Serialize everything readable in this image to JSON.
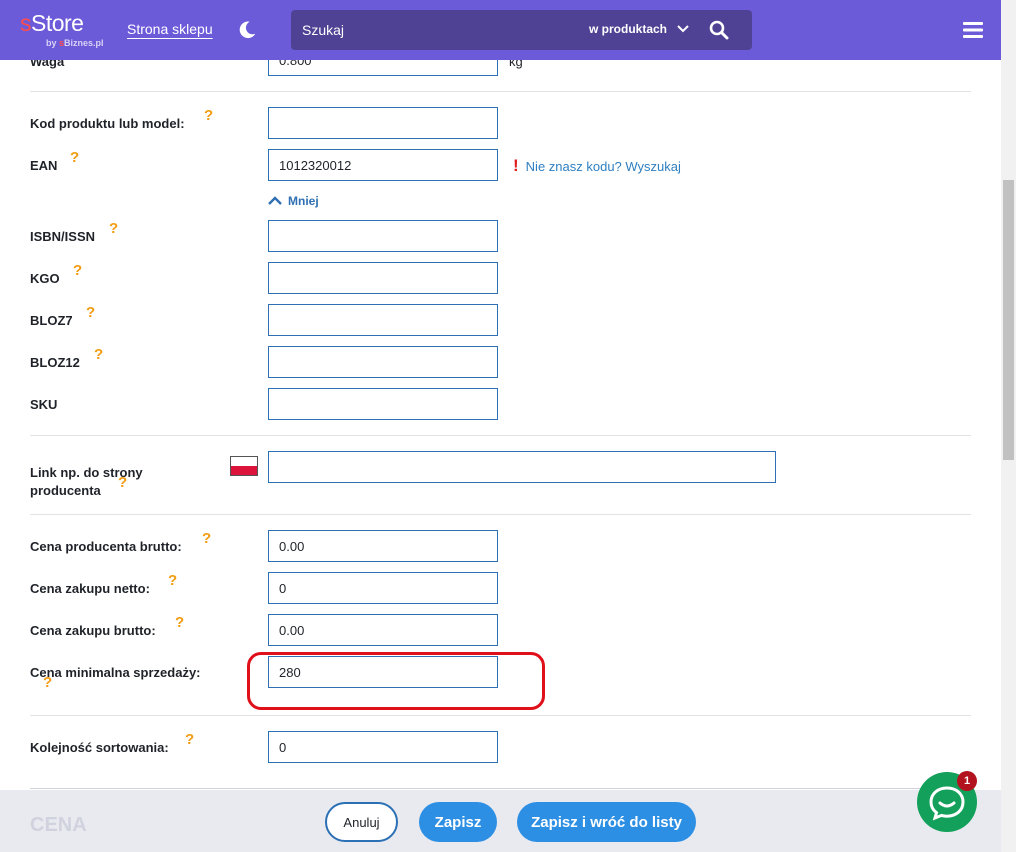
{
  "header": {
    "logo_main_s": "s",
    "logo_main_rest": "Store",
    "logo_sub_by": "by ",
    "logo_sub_s": "s",
    "logo_sub_rest": "Biznes.pl",
    "store_link": "Strona sklepu",
    "search_placeholder": "Szukaj",
    "search_scope": "w produktach"
  },
  "form": {
    "weight": {
      "label": "Waga",
      "value": "0.800",
      "unit": "kg"
    },
    "product_code": {
      "label": "Kod produktu lub model:",
      "value": ""
    },
    "ean": {
      "label": "EAN",
      "value": "1012320012",
      "hint": "Nie znasz kodu? Wyszukaj",
      "hint_mark": "!"
    },
    "less_toggle": "Mniej",
    "isbn": {
      "label": "ISBN/ISSN",
      "value": ""
    },
    "kgo": {
      "label": "KGO",
      "value": ""
    },
    "bloz7": {
      "label": "BLOZ7",
      "value": ""
    },
    "bloz12": {
      "label": "BLOZ12",
      "value": ""
    },
    "sku": {
      "label": "SKU",
      "value": ""
    },
    "manufacturer_link": {
      "label_line1": "Link np. do strony",
      "label_line2": "producenta",
      "value": ""
    },
    "manufacturer_price_gross": {
      "label": "Cena producenta brutto:",
      "value": "0.00"
    },
    "purchase_price_net": {
      "label": "Cena zakupu netto:",
      "value": "0"
    },
    "purchase_price_gross": {
      "label": "Cena zakupu brutto:",
      "value": "0.00"
    },
    "min_sale_price": {
      "label": "Cena minimalna sprzedaży:",
      "value": "280"
    },
    "sort_order": {
      "label": "Kolejność sortowania:",
      "value": "0"
    },
    "help_mark": "?"
  },
  "footer": {
    "section_heading": "CENA",
    "cancel_label": "Anuluj",
    "save_label": "Zapisz",
    "save_back_label": "Zapisz i wróć do listy"
  },
  "chat": {
    "badge_count": "1"
  },
  "colors": {
    "topbar": "#6c5bd9",
    "search_bg": "#4f4194",
    "help_icon": "#f39c12",
    "input_border": "#2f6fb3",
    "primary_button": "#2d8fe3",
    "highlight": "#e0101a",
    "chat": "#13a05a"
  }
}
